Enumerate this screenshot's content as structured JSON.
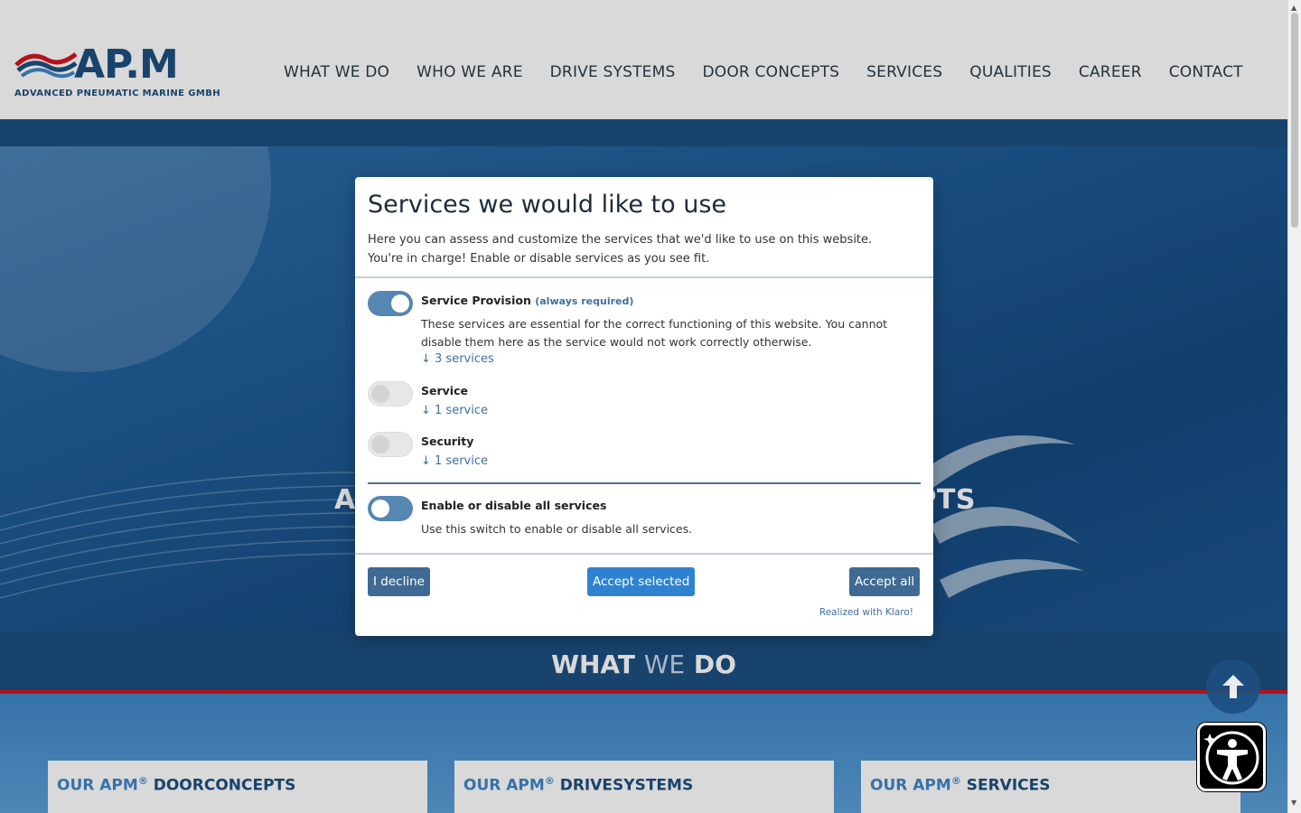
{
  "header": {
    "logo_text": "AP.M",
    "logo_sub": "ADVANCED PNEUMATIC MARINE GMBH",
    "nav": [
      "WHAT WE DO",
      "WHO WE ARE",
      "DRIVE SYSTEMS",
      "DOOR CONCEPTS",
      "SERVICES",
      "QUALITIES",
      "CAREER",
      "CONTACT"
    ]
  },
  "hero": {
    "title_left": "A",
    "title_right": "PTS"
  },
  "section": {
    "title_bold1": "WHAT",
    "title_light": "WE",
    "title_bold2": "DO"
  },
  "cards": [
    {
      "prefix": "OUR APM",
      "reg": "®",
      "name": "DOORCONCEPTS"
    },
    {
      "prefix": "OUR APM",
      "reg": "®",
      "name": "DRIVESYSTEMS"
    },
    {
      "prefix": "OUR APM",
      "reg": "®",
      "name": "SERVICES"
    }
  ],
  "modal": {
    "title": "Services we would like to use",
    "description": "Here you can assess and customize the services that we'd like to use on this website. You're in charge! Enable or disable services as you see fit.",
    "purposes": [
      {
        "title": "Service Provision",
        "required": "(always required)",
        "description": "These services are essential for the correct functioning of this website. You cannot disable them here as the service would not work correctly otherwise.",
        "link": "↓ 3 services",
        "enabled": true
      },
      {
        "title": "Service",
        "link": "↓ 1 service",
        "enabled": false
      },
      {
        "title": "Security",
        "link": "↓ 1 service",
        "enabled": false
      }
    ],
    "all_toggle": {
      "title": "Enable or disable all services",
      "description": "Use this switch to enable or disable all services.",
      "enabled": true
    },
    "buttons": {
      "decline": "I decline",
      "accept_selected": "Accept selected",
      "accept_all": "Accept all"
    },
    "footer_link": "Realized with Klaro!"
  },
  "icons": {
    "to_top": "arrow-up-icon",
    "accessibility": "accessibility-icon"
  },
  "colors": {
    "brand_blue": "#1d4f80",
    "accent_red": "#d8141e",
    "button_blue": "#2f82d0",
    "toggle_on": "#5686b2"
  }
}
